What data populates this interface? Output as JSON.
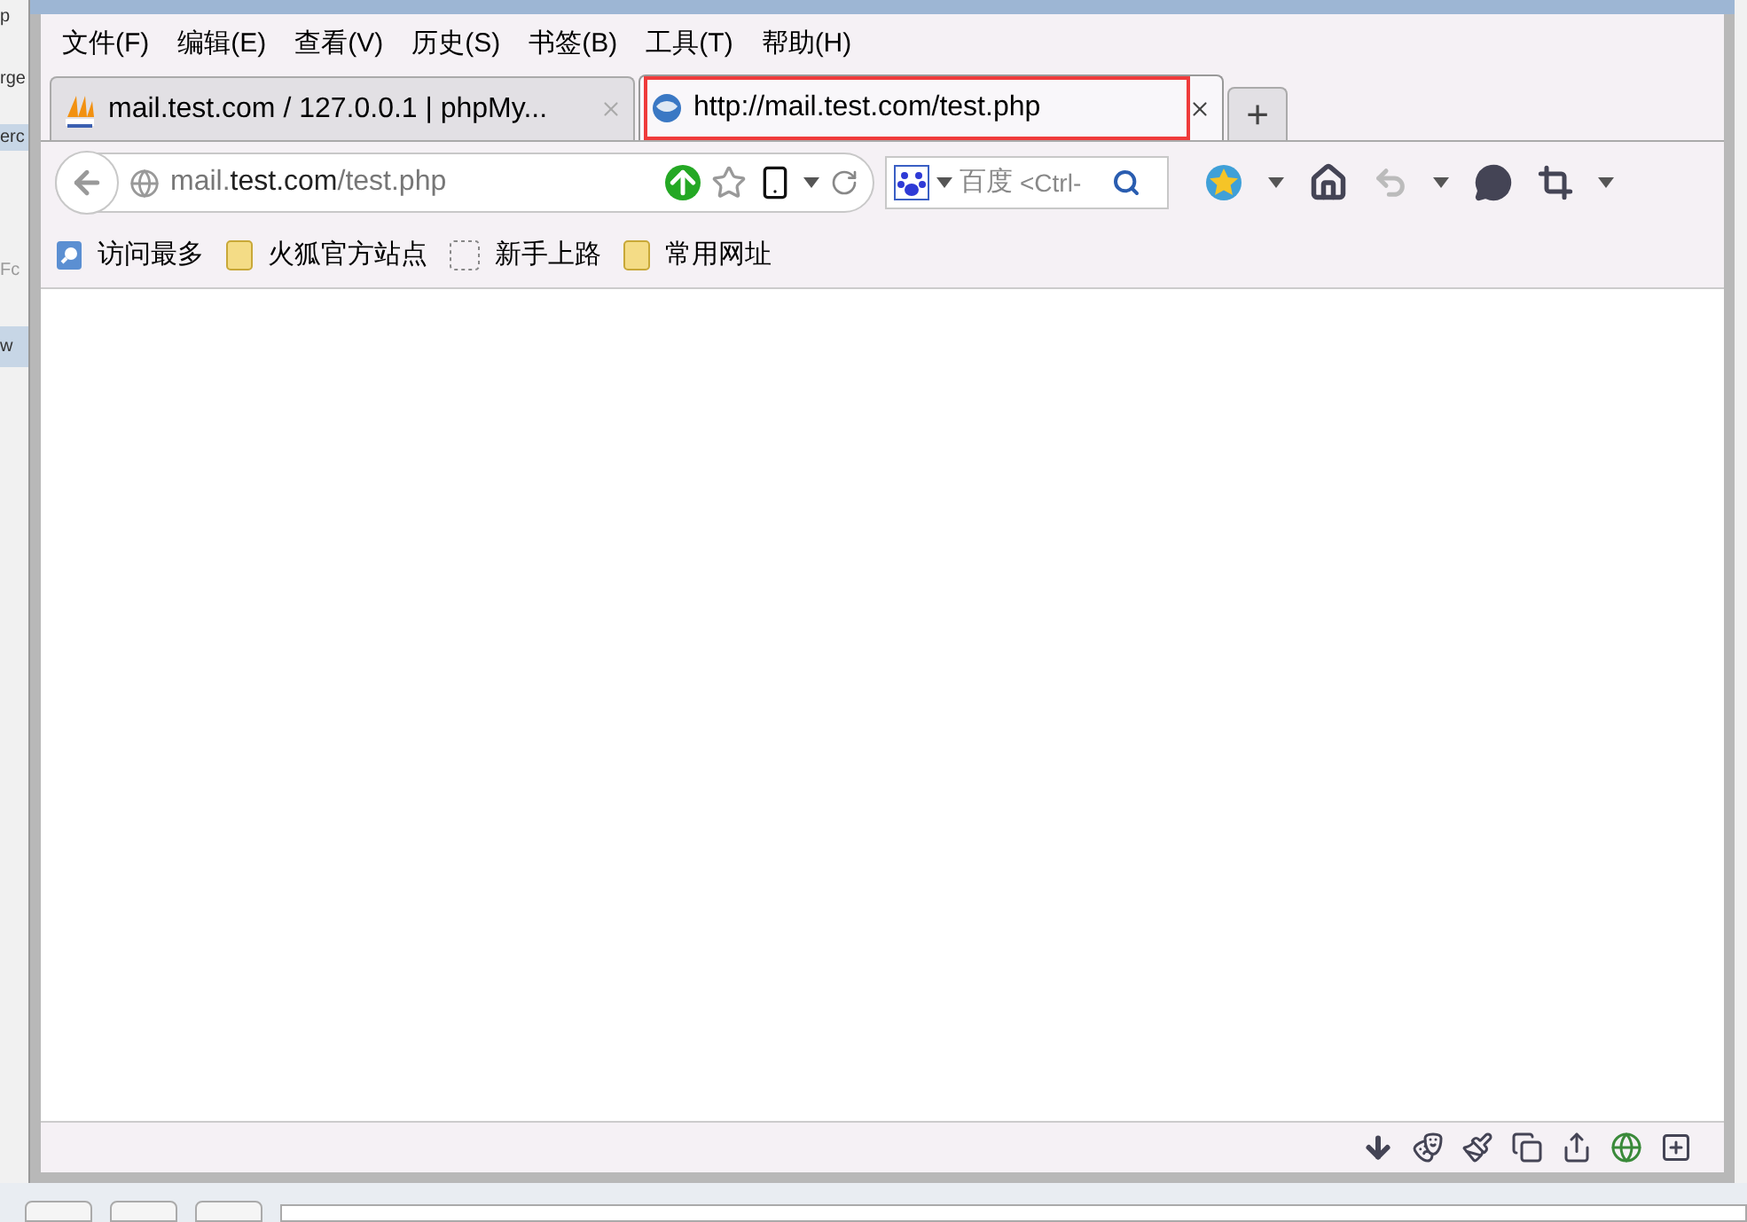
{
  "background_window": {
    "fragments": [
      "p",
      "rge",
      "erc",
      "Fc",
      "w"
    ]
  },
  "menu_bar": [
    "文件(F)",
    "编辑(E)",
    "查看(V)",
    "历史(S)",
    "书签(B)",
    "工具(T)",
    "帮助(H)"
  ],
  "tabs": [
    {
      "label": "mail.test.com / 127.0.0.1 | phpMy...",
      "kind": "pma",
      "selected": false,
      "highlighted": false
    },
    {
      "label": "http://mail.test.com/test.php",
      "kind": "page",
      "selected": true,
      "highlighted": true
    }
  ],
  "new_tab": "+",
  "address_bar": {
    "domain_prefix": "mail.",
    "domain": "test.com",
    "path": "/test.php"
  },
  "search_field": {
    "engine": "百度",
    "placeholder": "<Ctrl-"
  },
  "bookmarks": [
    {
      "label": "访问最多",
      "kind": "smart"
    },
    {
      "label": "火狐官方站点",
      "kind": "folder"
    },
    {
      "label": "新手上路",
      "kind": "empty"
    },
    {
      "label": "常用网址",
      "kind": "folder"
    }
  ]
}
